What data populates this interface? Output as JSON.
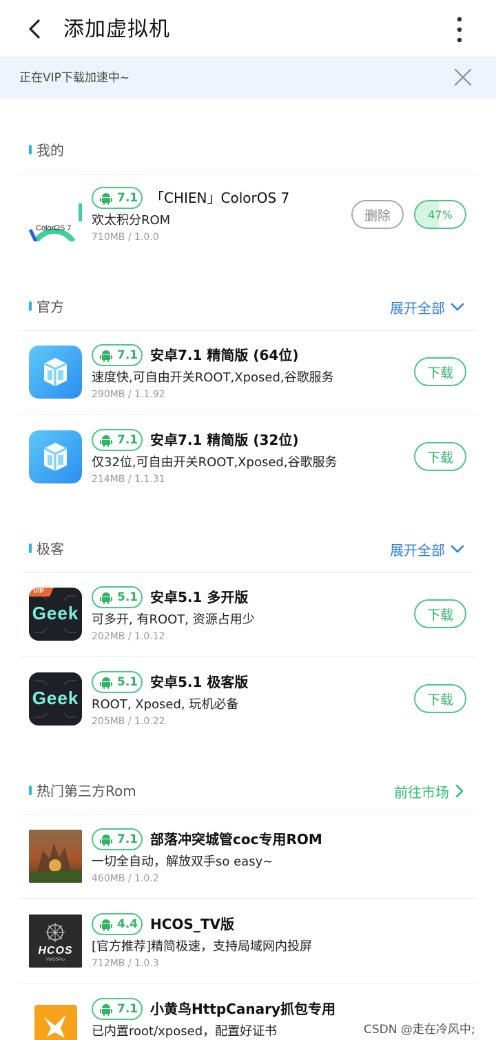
{
  "header": {
    "title": "添加虚拟机"
  },
  "vip_banner": {
    "text": "正在VIP下载加速中~"
  },
  "colors": {
    "accent_green": "#2fb466",
    "link_blue": "#2f7fe0",
    "section_bar": "#27b6e6",
    "banner_bg": "#eef4fb"
  },
  "sections": {
    "mine": {
      "title": "我的",
      "items": [
        {
          "android_version": "7.1",
          "name": "「CHIEN」ColorOS 7",
          "desc": "欢太积分ROM",
          "meta": "710MB / 1.0.0",
          "icon": "coloros-icon",
          "icon_text": "ColorOS 7",
          "delete_label": "删除",
          "progress_label": "47%",
          "progress": 0.47
        }
      ]
    },
    "official": {
      "title": "官方",
      "action": "展开全部",
      "items": [
        {
          "android_version": "7.1",
          "name": "安卓7.1 精简版 (64位)",
          "desc": "速度快,可自由开关ROOT,Xposed,谷歌服务",
          "meta": "290MB / 1.1.92",
          "icon": "vmos-cube-icon",
          "button": "下载"
        },
        {
          "android_version": "7.1",
          "name": "安卓7.1 精简版 (32位)",
          "desc": "仅32位,可自由开关ROOT,Xposed,谷歌服务",
          "meta": "214MB / 1.1.31",
          "icon": "vmos-cube-icon",
          "button": "下载"
        }
      ]
    },
    "geek": {
      "title": "极客",
      "action": "展开全部",
      "items": [
        {
          "android_version": "5.1",
          "name": "安卓5.1 多开版",
          "desc": "可多开, 有ROOT, 资源占用少",
          "meta": "202MB / 1.0.12",
          "icon": "geek-icon",
          "icon_text": "Geek",
          "vip_tag": "VIP",
          "button": "下载"
        },
        {
          "android_version": "5.1",
          "name": "安卓5.1 极客版",
          "desc": "ROOT, Xposed, 玩机必备",
          "meta": "205MB / 1.0.22",
          "icon": "geek-icon",
          "icon_text": "Geek",
          "button": "下载"
        }
      ]
    },
    "third_party": {
      "title": "热门第三方Rom",
      "action": "前往市场",
      "items": [
        {
          "android_version": "7.1",
          "name": "部落冲突城管coc专用ROM",
          "desc": "一切全自动，解放双手so easy~",
          "meta": "460MB / 1.0.2",
          "icon": "clash-of-clans-icon"
        },
        {
          "android_version": "4.4",
          "name": "HCOS_TV版",
          "desc": "[官方推荐]精简极速，支持局域网内投屏",
          "meta": "712MB / 1.0.3",
          "icon": "hcos-icon",
          "icon_text": "HCOS",
          "icon_subtext": "VMOSPro"
        },
        {
          "android_version": "7.1",
          "name": "小黄鸟HttpCanary抓包专用",
          "desc": "已内置root/xposed，配置好证书",
          "icon": "httpcanary-bird-icon"
        }
      ]
    }
  },
  "watermark": "CSDN @走在冷风中;"
}
